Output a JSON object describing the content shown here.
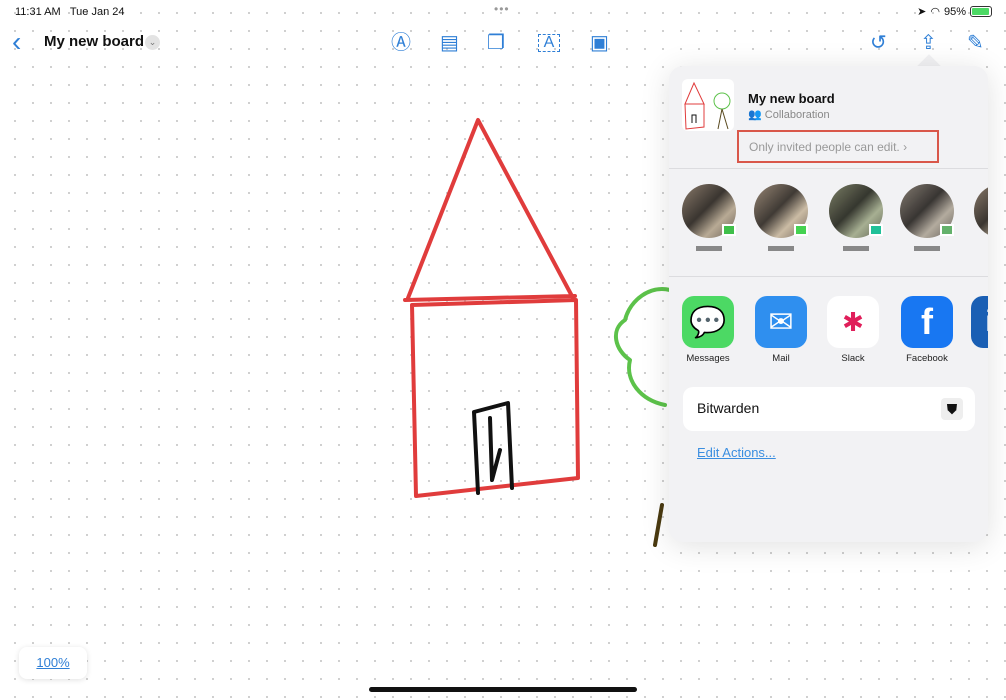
{
  "status": {
    "time": "11:31 AM",
    "date": "Tue Jan 24",
    "battery": "95%",
    "multitask": "•••"
  },
  "toolbar": {
    "title": "My new board",
    "back": "‹",
    "icons": [
      "pen-icon",
      "note-icon",
      "shapes-icon",
      "text-box-icon",
      "media-icon",
      "undo-icon",
      "share-icon",
      "compose-icon"
    ]
  },
  "share": {
    "title": "My new board",
    "subtitle": "Collaboration",
    "permission": "Only invited people can edit.",
    "permission_chevron": "›",
    "apps": [
      {
        "label": "Messages",
        "color": "#4cd964"
      },
      {
        "label": "Mail",
        "color": "#2f8fef"
      },
      {
        "label": "Slack",
        "color": "#ffffff"
      },
      {
        "label": "Facebook",
        "color": "#1877f2"
      },
      {
        "label": "Li",
        "color": "#1a5fb4"
      }
    ],
    "action": "Bitwarden",
    "edit_actions": "Edit Actions..."
  },
  "zoom": "100%",
  "colors": {
    "accent": "#2f7fd6",
    "highlight": "#d9574a",
    "house": "#e03c3c",
    "tree": "#5cc24a"
  }
}
